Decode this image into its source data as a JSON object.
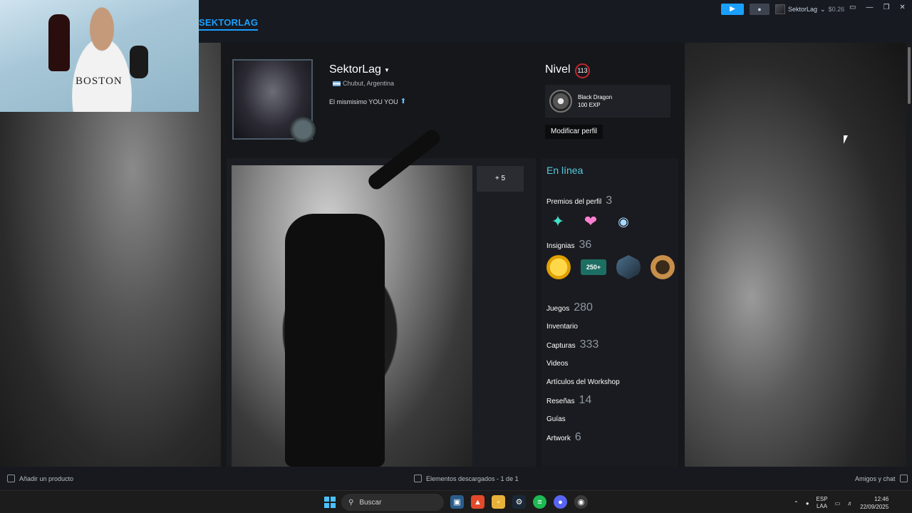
{
  "topbar": {
    "brand": "SEKTORLAG",
    "user_name": "SektorLag",
    "wallet": "$0.26"
  },
  "profile": {
    "persona_name": "SektorLag",
    "location": "Chubut, Argentina",
    "summary": "El mismisimo YOU YOU",
    "level_label": "Nivel",
    "level_value": "113",
    "featured_badge": {
      "name": "Black Dragon",
      "xp": "100 EXP"
    },
    "edit_button": "Modificar perfil"
  },
  "showcase": {
    "more_label": "+ 5"
  },
  "sidebar": {
    "status": "En línea",
    "awards_label": "Premios del perfil",
    "awards_count": "3",
    "badges_label": "Insignias",
    "badges_count": "36",
    "badge_years_text": "250+",
    "items": [
      {
        "label": "Juegos",
        "count": "280"
      },
      {
        "label": "Inventario",
        "count": ""
      },
      {
        "label": "Capturas",
        "count": "333"
      },
      {
        "label": "Videos",
        "count": ""
      },
      {
        "label": "Artículos del Workshop",
        "count": ""
      },
      {
        "label": "Reseñas",
        "count": "14"
      },
      {
        "label": "Guías",
        "count": ""
      },
      {
        "label": "Artwork",
        "count": "6"
      }
    ]
  },
  "statusbar": {
    "add_product": "Añadir un producto",
    "downloads": "Elementos descargados - 1 de 1",
    "friends": "Amigos y chat"
  },
  "webcam": {
    "shirt_text": "BOSTON"
  },
  "taskbar": {
    "search_label": "Buscar",
    "lang_line1": "ESP",
    "lang_line2": "LAA",
    "time": "12:46",
    "date": "22/09/2025"
  },
  "colors": {
    "accent": "#1a9fff",
    "online": "#57cbde",
    "level_ring": "#c2262e"
  }
}
